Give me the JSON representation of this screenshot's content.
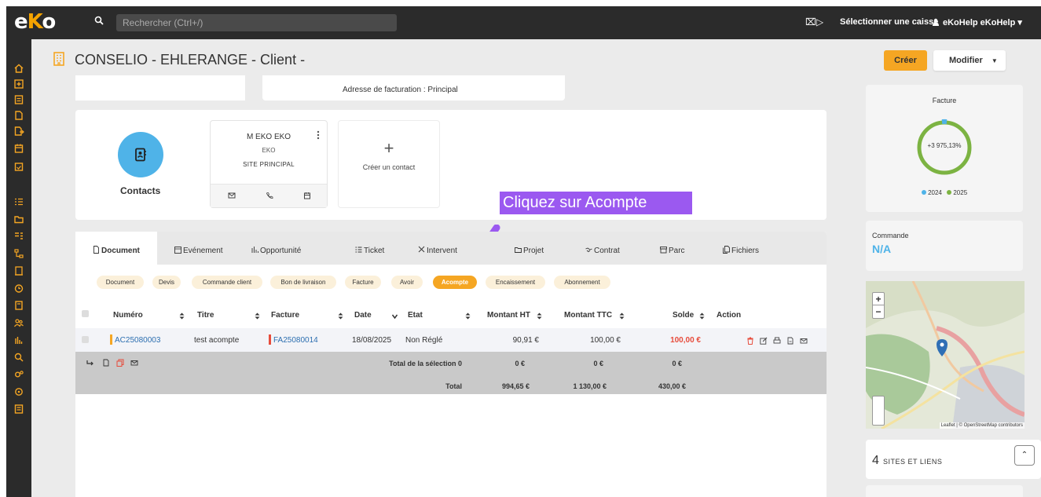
{
  "app": {
    "logo_text": "eKo",
    "brand_color": "#f5a623"
  },
  "topbar": {
    "search_placeholder": "Rechercher (Ctrl+/)",
    "caisse_label": "Sélectionner une caisse",
    "user_label": "eKoHelp eKoHelp ▾"
  },
  "header": {
    "title": "CONSELIO - EHLERANGE - Client -",
    "create_label": "Créer",
    "modify_label": "Modifier"
  },
  "address": {
    "text": "Adresse de facturation : Principal"
  },
  "contacts": {
    "section_label": "Contacts",
    "person": {
      "name": "M EKO EKO",
      "sub": "EKO",
      "site": "SITE PRINCIPAL"
    },
    "new_contact_label": "Créer un contact",
    "plus": "+"
  },
  "tooltip": {
    "text": "Cliquez sur Acompte"
  },
  "tabs": [
    {
      "label": "Document",
      "icon": "document-icon"
    },
    {
      "label": "Evénement",
      "icon": "calendar-icon"
    },
    {
      "label": "Opportunité",
      "icon": "chart-icon"
    },
    {
      "label": "Ticket",
      "icon": "list-icon"
    },
    {
      "label": "Intervent",
      "icon": "tools-icon"
    },
    {
      "label": "Projet",
      "icon": "folder-icon"
    },
    {
      "label": "Contrat",
      "icon": "handshake-icon"
    },
    {
      "label": "Parc",
      "icon": "archive-icon"
    },
    {
      "label": "Fichiers",
      "icon": "files-icon"
    }
  ],
  "filters": [
    "Document",
    "Devis",
    "Commande client",
    "Bon de livraison",
    "Facture",
    "Avoir",
    "Acompte",
    "Encaissement",
    "Abonnement"
  ],
  "table": {
    "headers": {
      "numero": "Numéro",
      "titre": "Titre",
      "facture": "Facture",
      "date": "Date",
      "etat": "Etat",
      "montant_ht": "Montant HT",
      "montant_ttc": "Montant TTC",
      "solde": "Solde",
      "action": "Action"
    },
    "row": {
      "numero": "AC25080003",
      "titre": "test acompte",
      "facture": "FA25080014",
      "date": "18/08/2025",
      "etat": "Non Réglé",
      "montant_ht": "90,91 €",
      "montant_ttc": "100,00 €",
      "solde": "100,00 €"
    },
    "selection": {
      "label": "Total de la sélection 0",
      "ht": "0 €",
      "ttc": "0 €",
      "solde": "0 €"
    },
    "total": {
      "label": "Total",
      "ht": "994,65 €",
      "ttc": "1 130,00 €",
      "solde": "430,00 €"
    }
  },
  "facture_widget": {
    "title": "Facture",
    "center_label": "+3 975,13%",
    "legend": [
      {
        "label": "2024",
        "color": "#4fb3e8"
      },
      {
        "label": "2025",
        "color": "#7cb342"
      }
    ]
  },
  "commande_widget": {
    "title": "Commande",
    "value": "N/A"
  },
  "map": {
    "credit": "Leaflet | © OpenStreetMap contributors",
    "zoom_in": "+",
    "zoom_out": "−"
  },
  "sites": {
    "count": "4",
    "label": "SITES ET LIENS"
  }
}
